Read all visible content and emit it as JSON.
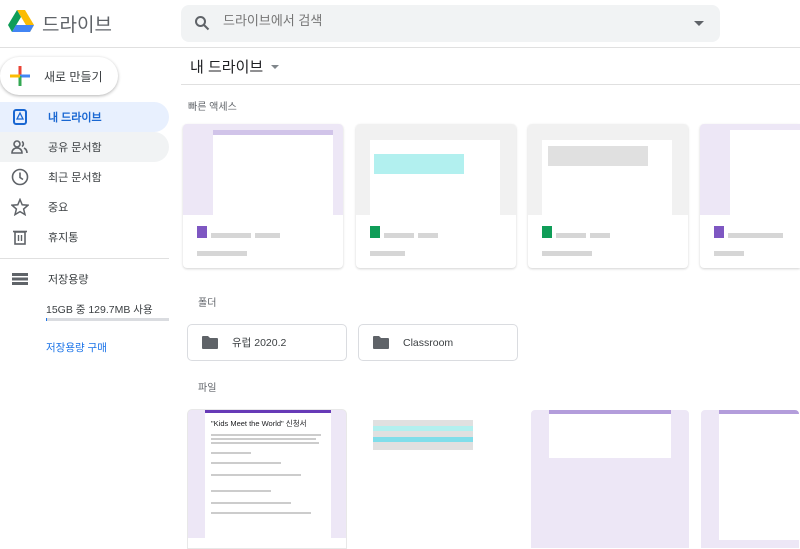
{
  "header": {
    "app_name": "드라이브",
    "search_placeholder": "드라이브에서 검색"
  },
  "sidebar": {
    "new_label": "새로 만들기",
    "items": [
      {
        "label": "내 드라이브",
        "icon": "my-drive-icon"
      },
      {
        "label": "공유 문서함",
        "icon": "shared-icon"
      },
      {
        "label": "최근 문서함",
        "icon": "clock-icon"
      },
      {
        "label": "중요",
        "icon": "star-icon"
      },
      {
        "label": "휴지통",
        "icon": "trash-icon"
      }
    ],
    "storage_label": "저장용량",
    "storage_usage": "15GB 중 129.7MB 사용",
    "storage_fraction": 0.0084,
    "buy_storage": "저장용량 구매"
  },
  "main": {
    "title": "내 드라이브",
    "quick_access_label": "빠른 액세스",
    "folders_label": "폴더",
    "folders": [
      {
        "name": "유럽 2020.2"
      },
      {
        "name": "Classroom"
      }
    ],
    "files_label": "파일",
    "files": [
      {
        "preview_title": "\"Kids Meet the World\" 신청서"
      }
    ]
  },
  "colors": {
    "accent": "#1a73e8",
    "active_bg": "#e8f0fe",
    "forms_purple": "#673ab7",
    "sheets_green": "#0f9d58"
  }
}
